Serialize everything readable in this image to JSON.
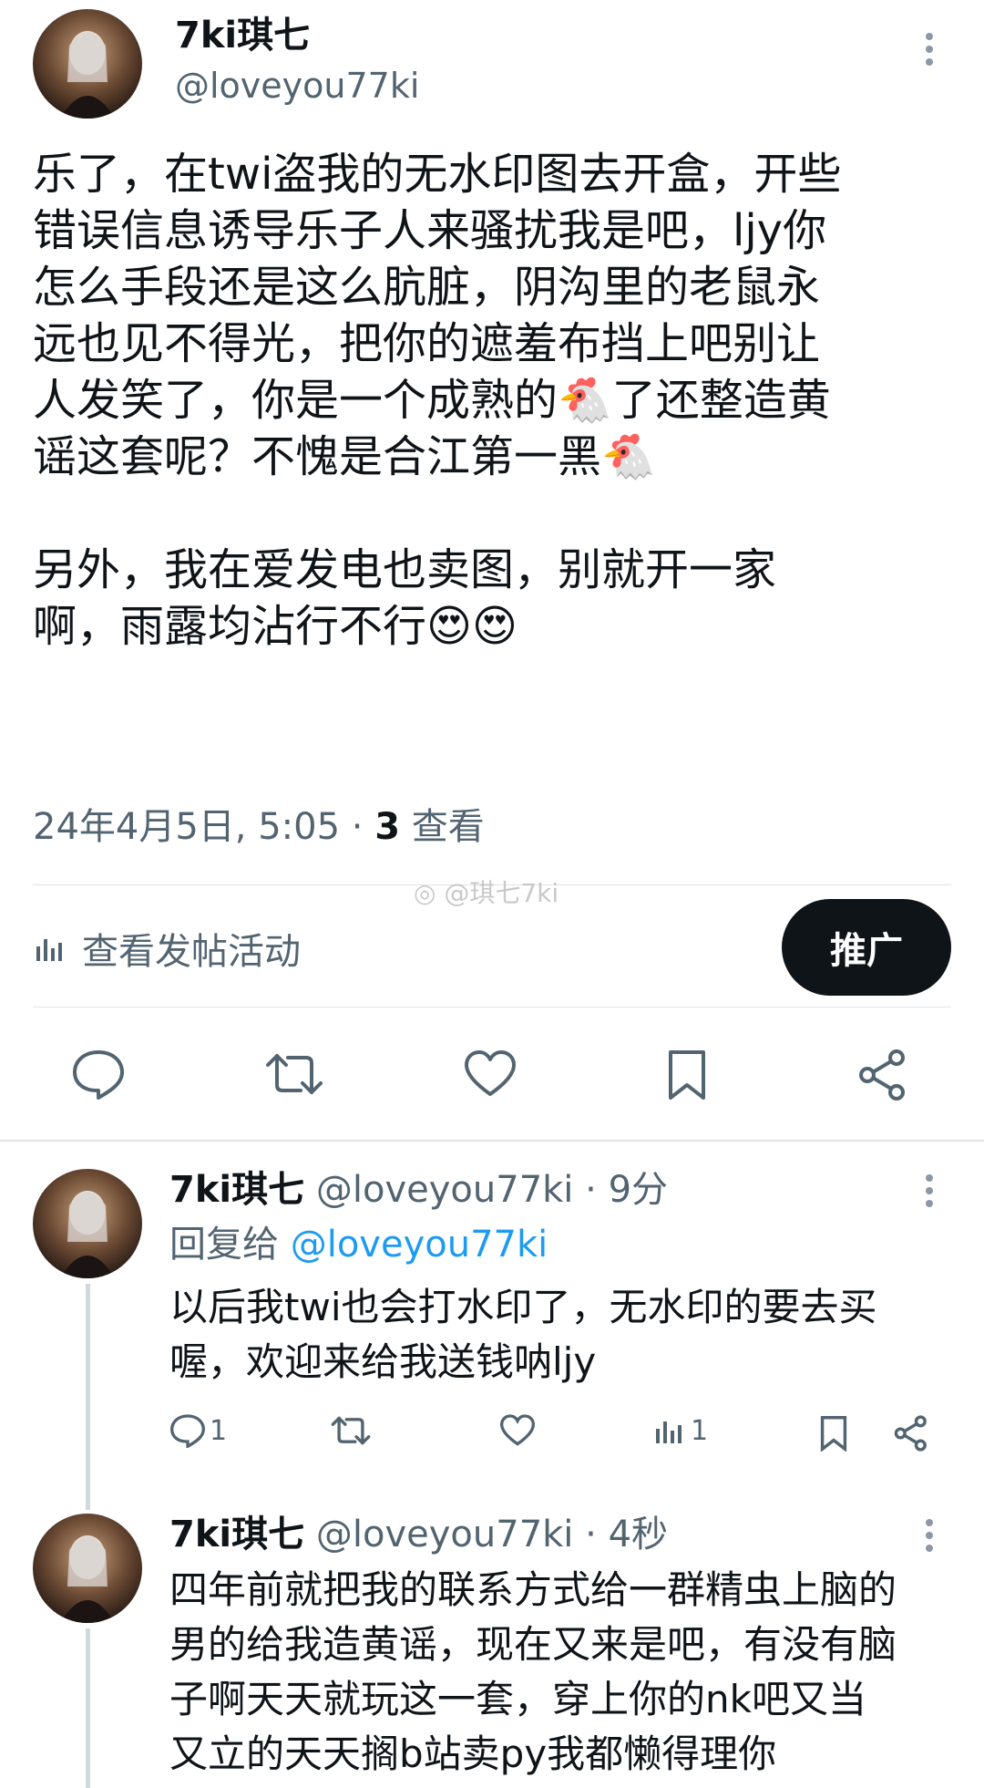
{
  "main_tweet": {
    "display_name": "7ki琪七",
    "handle": "@loveyou77ki",
    "lines": [
      "乐了，在twi盗我的无水印图去开盒，开些",
      "错误信息诱导乐子人来骚扰我是吧，ljy你",
      "怎么手段还是这么肮脏，阴沟里的老鼠永",
      "远也见不得光，把你的遮羞布挡上吧别让",
      "人发笑了，你是一个成熟的🐔了还整造黄",
      "谣这套呢？不愧是合江第一黑🐔",
      "",
      "另外，我在爱发电也卖图，别就开一家",
      "啊，雨露均沾行不行😍😍"
    ],
    "timestamp": "24年4月5日, 5:05 · ",
    "views_count": "3",
    "views_label": " 查看",
    "activity_label": "查看发帖活动",
    "promote_label": "推广"
  },
  "watermark": "@琪七7ki",
  "replies": [
    {
      "display_name": "7ki琪七",
      "handle": "@loveyou77ki",
      "time": " · 9分",
      "reply_to_prefix": "回复给 ",
      "reply_to_handle": "@loveyou77ki",
      "lines": [
        "以后我twi也会打水印了，无水印的要去买",
        "喔，欢迎来给我送钱呐ljy"
      ],
      "reply_count": "1",
      "retweet_count": "",
      "like_count": "",
      "views_count": "1"
    },
    {
      "display_name": "7ki琪七",
      "handle": "@loveyou77ki",
      "time": " · 4秒",
      "lines": [
        "四年前就把我的联系方式给一群精虫上脑的",
        "男的给我造黄谣，现在又来是吧，有没有脑",
        "子啊天天就玩这一套，穿上你的nk吧又当",
        "又立的天天搁b站卖py我都懒得理你"
      ]
    }
  ],
  "colors": {
    "text": "#0f1419",
    "secondary": "#536471",
    "link": "#1d9bf0",
    "promote_bg": "#0f1419"
  },
  "icons": [
    "more-icon",
    "reply-icon",
    "retweet-icon",
    "like-icon",
    "bookmark-icon",
    "share-icon",
    "analytics-icon"
  ]
}
